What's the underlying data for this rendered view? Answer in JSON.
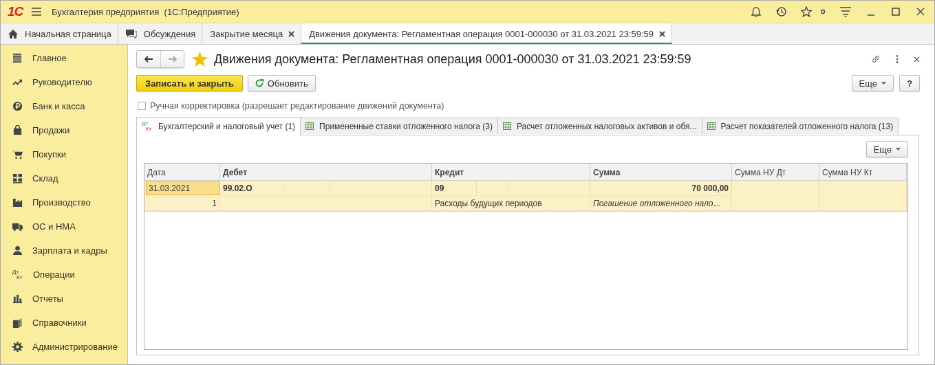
{
  "window": {
    "logo": "1С",
    "title": "Бухгалтерия предприятия  (1С:Предприятие)"
  },
  "open_tabs": [
    {
      "label": "Начальная страница",
      "selected": false,
      "kind": "home"
    },
    {
      "label": "Обсуждения",
      "selected": false,
      "kind": "chat"
    },
    {
      "label": "Закрытие месяца",
      "selected": false,
      "kind": "closable"
    },
    {
      "label": "Движения документа: Регламентная операция 0001-000030 от 31.03.2021 23:59:59",
      "selected": true,
      "kind": "closable"
    }
  ],
  "sidebar": {
    "items": [
      {
        "label": "Главное"
      },
      {
        "label": "Руководителю"
      },
      {
        "label": "Банк и касса"
      },
      {
        "label": "Продажи"
      },
      {
        "label": "Покупки"
      },
      {
        "label": "Склад"
      },
      {
        "label": "Производство"
      },
      {
        "label": "ОС и НМА"
      },
      {
        "label": "Зарплата и кадры"
      },
      {
        "label": "Операции",
        "icon_top": "Дт",
        "icon_bottom": "Кт"
      },
      {
        "label": "Отчеты"
      },
      {
        "label": "Справочники"
      },
      {
        "label": "Администрирование"
      }
    ]
  },
  "form": {
    "title": "Движения документа: Регламентная операция 0001-000030 от 31.03.2021 23:59:59",
    "buttons": [
      {
        "label": "Записать и закрыть",
        "kind": "primary"
      },
      {
        "label": "Обновить",
        "kind": "refresh"
      }
    ],
    "more_button": "Еще",
    "help_button": "?",
    "manual_edit": {
      "label": "Ручная корректировка (разрешает редактирование движений документа)",
      "checked": false
    },
    "tabs": [
      {
        "label": "Бухгалтерский и налоговый учет (1)",
        "selected": true,
        "icon_top": "Дт",
        "icon_bottom": "Кт"
      },
      {
        "label": "Примененные ставки отложенного налога (3)",
        "selected": false
      },
      {
        "label": "Расчет отложенных налоговых активов и обя...",
        "selected": false
      },
      {
        "label": "Расчет показателей отложенного налога (13)",
        "selected": false
      }
    ],
    "table_more_button": "Еще",
    "table": {
      "columns": [
        {
          "label": "Дата",
          "bold": false
        },
        {
          "label": "Дебет",
          "bold": true
        },
        {
          "label": "Кредит",
          "bold": true
        },
        {
          "label": "Сумма",
          "bold": true
        },
        {
          "label": "Сумма НУ Дт",
          "bold": false
        },
        {
          "label": "Сумма НУ Кт",
          "bold": false
        }
      ],
      "rows": [
        {
          "selected": true,
          "date": "31.03.2021",
          "number": "1",
          "debit": "99.02.О",
          "credit": "09",
          "credit_subconto": "Расходы будущих периодов",
          "amount": "70 000,00",
          "content": "Погашение отложенного нало…"
        }
      ]
    }
  }
}
